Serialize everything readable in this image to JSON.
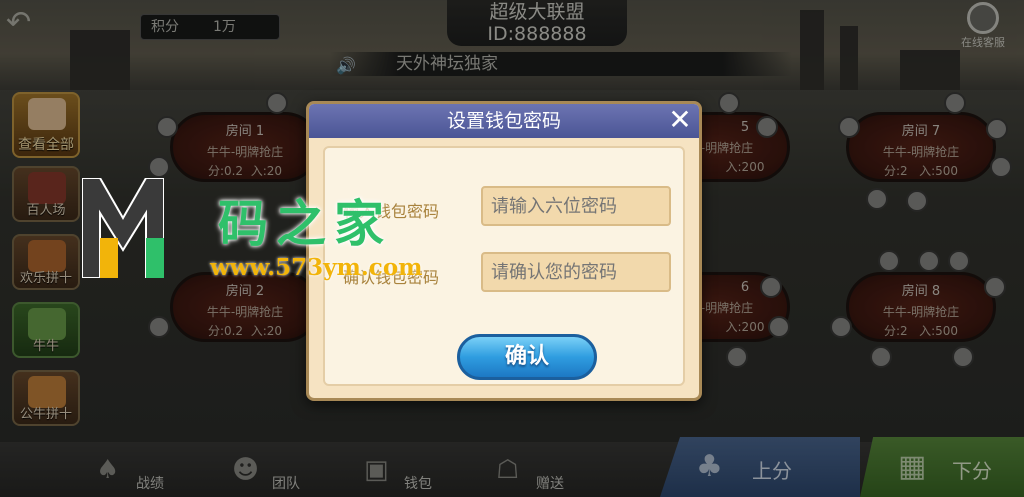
{
  "header": {
    "title": "超级大联盟",
    "room_id": "ID:888888",
    "score_label": "积分",
    "score_value": "1万",
    "online_service_label": "在线客服",
    "marquee_text": "天外神坛独家"
  },
  "sidebar": {
    "items": [
      {
        "label": "查看全部"
      },
      {
        "label": "百人场"
      },
      {
        "label": "欢乐拼十"
      },
      {
        "label": "牛牛"
      },
      {
        "label": "公牛拼十"
      }
    ]
  },
  "rooms": [
    {
      "name": "房间 1",
      "mode": "牛牛-明牌抢庄",
      "base": "分:0.2",
      "entry": "入:20"
    },
    {
      "name": "房间 2",
      "mode": "牛牛-明牌抢庄",
      "base": "分:0.2",
      "entry": "入:20"
    },
    {
      "name": "5",
      "mode": "牛牛-明牌抢庄",
      "base": "",
      "entry": "入:200"
    },
    {
      "name": "6",
      "mode": "牛牛-明牌抢庄",
      "base": "",
      "entry": "入:200"
    },
    {
      "name": "房间 7",
      "mode": "牛牛-明牌抢庄",
      "base": "分:2",
      "entry": "入:500"
    },
    {
      "name": "房间 8",
      "mode": "牛牛-明牌抢庄",
      "base": "分:2",
      "entry": "入:500"
    }
  ],
  "bottom_nav": {
    "record": "战绩",
    "team": "团队",
    "wallet": "钱包",
    "gift": "赠送",
    "deposit": "上分",
    "withdraw": "下分"
  },
  "dialog": {
    "title": "设置钱包密码",
    "field1_label": "输入钱包密码",
    "field1_placeholder": "请输入六位密码",
    "field2_label": "确认钱包密码",
    "field2_placeholder": "请确认您的密码",
    "confirm_label": "确认"
  },
  "watermark": {
    "logo_text": "M",
    "title": "码之家",
    "url": "www.573ym.com"
  },
  "colors": {
    "dialog_header": "#5a63a5",
    "dialog_bg": "#f6e3c2",
    "input_bg": "#f2d9ac",
    "confirm_btn": "#2f9de0",
    "deposit_btn": "#3d5a86",
    "withdraw_btn": "#4b7c31",
    "watermark_green": "#2fc06a",
    "watermark_orange": "#f2b40a"
  }
}
